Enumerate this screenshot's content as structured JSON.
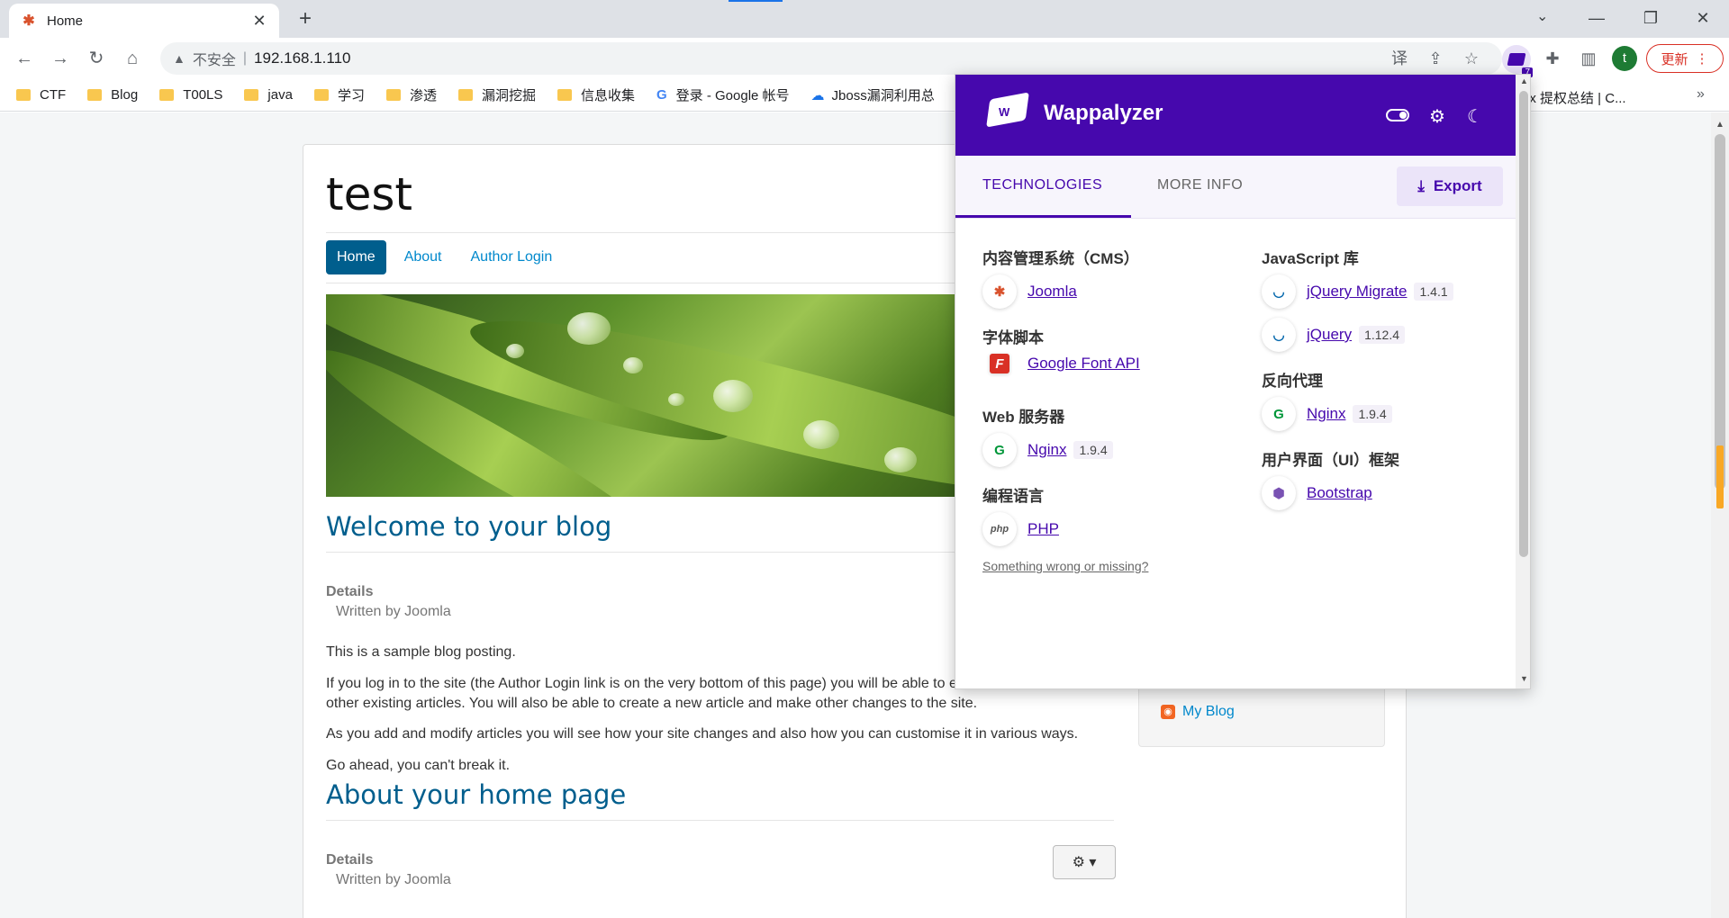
{
  "browser": {
    "tab_title": "Home",
    "url": "192.168.1.110",
    "insecure_label": "不安全",
    "update_label": "更新",
    "profile_initial": "t",
    "extension_badge": "7"
  },
  "bookmarks": [
    {
      "label": "CTF",
      "type": "folder"
    },
    {
      "label": "Blog",
      "type": "folder"
    },
    {
      "label": "T00LS",
      "type": "folder"
    },
    {
      "label": "java",
      "type": "folder"
    },
    {
      "label": "学习",
      "type": "folder"
    },
    {
      "label": "渗透",
      "type": "folder"
    },
    {
      "label": "漏洞挖掘",
      "type": "folder"
    },
    {
      "label": "信息收集",
      "type": "folder"
    },
    {
      "label": "登录 - Google 帐号",
      "type": "google"
    },
    {
      "label": "Jboss漏洞利用总",
      "type": "cloud"
    }
  ],
  "bookmark_right": "ux 提权总结 | C...",
  "site": {
    "title": "test",
    "nav": [
      {
        "label": "Home",
        "active": true
      },
      {
        "label": "About",
        "active": false
      },
      {
        "label": "Author Login",
        "active": false
      }
    ],
    "article1": {
      "heading": "Welcome to your blog",
      "details_label": "Details",
      "written_by": "Written by Joomla",
      "paragraphs": [
        "This is a sample blog posting.",
        "If you log in to the site (the Author Login link is on the very bottom of this page) you will be able to edit it and all of the other existing articles. You will also be able to create a new article and make other changes to the site.",
        "As you add and modify articles you will see how your site changes and also how you can customise it in various ways.",
        "Go ahead, you can't break it."
      ]
    },
    "article2": {
      "heading": "About your home page",
      "details_label": "Details",
      "written_by": "Written by Joomla"
    },
    "sidebar_link": "My Blog"
  },
  "wappalyzer": {
    "brand": "Wappalyzer",
    "tabs": [
      "TECHNOLOGIES",
      "MORE INFO"
    ],
    "export_label": "Export",
    "left_column": [
      {
        "category": "内容管理系统（CMS）",
        "items": [
          {
            "name": "Joomla",
            "version": "",
            "icon": "joomla-icon"
          }
        ]
      },
      {
        "category": "字体脚本",
        "items": [
          {
            "name": "Google Font API",
            "version": "",
            "icon": "google-font-icon"
          }
        ]
      },
      {
        "category": "Web 服务器",
        "items": [
          {
            "name": "Nginx",
            "version": "1.9.4",
            "icon": "nginx-icon"
          }
        ]
      },
      {
        "category": "编程语言",
        "items": [
          {
            "name": "PHP",
            "version": "",
            "icon": "php-icon"
          }
        ]
      }
    ],
    "right_column": [
      {
        "category": "JavaScript 库",
        "items": [
          {
            "name": "jQuery Migrate",
            "version": "1.4.1",
            "icon": "jquery-icon"
          },
          {
            "name": "jQuery",
            "version": "1.12.4",
            "icon": "jquery-icon"
          }
        ]
      },
      {
        "category": "反向代理",
        "items": [
          {
            "name": "Nginx",
            "version": "1.9.4",
            "icon": "nginx-icon"
          }
        ]
      },
      {
        "category": "用户界面（UI）框架",
        "items": [
          {
            "name": "Bootstrap",
            "version": "",
            "icon": "bootstrap-icon"
          }
        ]
      }
    ],
    "footer_link": "Something wrong or missing?"
  },
  "colors": {
    "wappalyzer_purple": "#4608ad",
    "joomla_blue": "#005e8d",
    "link_blue": "#0088cc"
  }
}
